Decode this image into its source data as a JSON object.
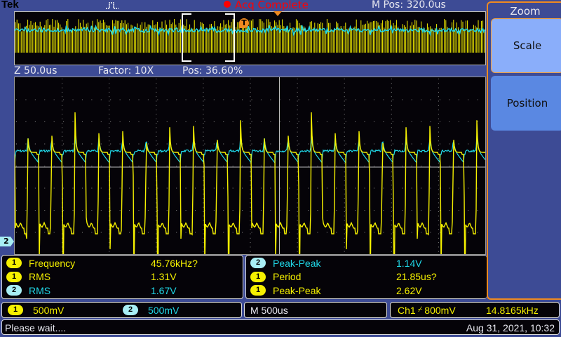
{
  "brand": "Tek",
  "icons": {
    "trigger_pulse": "pulse-waveform-icon",
    "acq_status": "red-dot-icon"
  },
  "header": {
    "acq_status": "Acq Complete",
    "m_pos": "M Pos: 320.0us"
  },
  "zoom_info": {
    "scale": "Z 50.0us",
    "factor": "Factor: 10X",
    "pos": "Pos: 36.60%"
  },
  "overview": {
    "trigger_marker": "T"
  },
  "channel_marker": "2",
  "side_menu": {
    "title": "Zoom",
    "buttons": [
      {
        "label": "Scale"
      },
      {
        "label": "Position"
      }
    ]
  },
  "measurements_left": [
    {
      "ch": "1",
      "name": "Frequency",
      "value": "45.76kHz?"
    },
    {
      "ch": "1",
      "name": "RMS",
      "value": "1.31V"
    },
    {
      "ch": "2",
      "name": "RMS",
      "value": "1.67V"
    }
  ],
  "measurements_right": [
    {
      "ch": "2",
      "name": "Peak-Peak",
      "value": "1.14V"
    },
    {
      "ch": "1",
      "name": "Period",
      "value": "21.85us?"
    },
    {
      "ch": "1",
      "name": "Peak-Peak",
      "value": "2.62V"
    }
  ],
  "channels": [
    {
      "ch": "1",
      "scale": "500mV"
    },
    {
      "ch": "2",
      "scale": "500mV"
    }
  ],
  "timebase": "M 500us",
  "trigger": {
    "source": "Ch1",
    "slope": "⌿",
    "level": "800mV",
    "freq": "14.8165kHz"
  },
  "status": {
    "message": "Please wait....",
    "datetime": "Aug 31, 2021, 10:32"
  },
  "colors": {
    "ch1": "#f5f000",
    "ch2": "#20d8e8",
    "background": "#3d4b95",
    "acq": "#ff0000",
    "menu_border": "#f08a20"
  }
}
